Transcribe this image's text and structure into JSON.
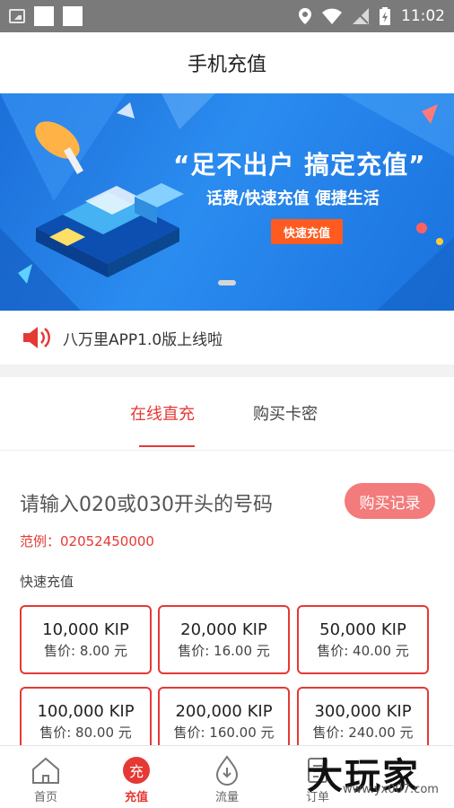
{
  "status_bar": {
    "time": "11:02"
  },
  "header": {
    "title": "手机充值"
  },
  "banner": {
    "headline": "“足不出户  搞定充值”",
    "subline": "话费/快速充值  便捷生活",
    "button_label": "快速充值"
  },
  "notice": {
    "text": "八万里APP1.0版上线啦"
  },
  "tabs": [
    {
      "label": "在线直充",
      "active": true
    },
    {
      "label": "购买卡密",
      "active": false
    }
  ],
  "recharge": {
    "prompt": "请输入020或030开头的号码",
    "record_button": "购买记录",
    "example": "范例：02052450000",
    "quick_label": "快速充值",
    "options": [
      {
        "amount": "10,000 KIP",
        "price": "售价: 8.00 元"
      },
      {
        "amount": "20,000 KIP",
        "price": "售价: 16.00 元"
      },
      {
        "amount": "50,000 KIP",
        "price": "售价: 40.00 元"
      },
      {
        "amount": "100,000 KIP",
        "price": "售价: 80.00 元"
      },
      {
        "amount": "200,000 KIP",
        "price": "售价: 160.00 元"
      },
      {
        "amount": "300,000 KIP",
        "price": "售价: 240.00 元"
      }
    ]
  },
  "bottom_nav": [
    {
      "label": "首页",
      "icon": "home-icon",
      "active": false
    },
    {
      "label": "充值",
      "icon": "charge-icon",
      "glyph": "充",
      "active": true
    },
    {
      "label": "流量",
      "icon": "data-drop-icon",
      "active": false
    },
    {
      "label": "订单",
      "icon": "order-icon",
      "active": false
    }
  ],
  "watermark": {
    "brand": "大玩家",
    "url": "www.yx007.com"
  },
  "colors": {
    "accent": "#e53935",
    "banner_blue": "#2b8cf0",
    "button_orange": "#ff5a1f"
  }
}
